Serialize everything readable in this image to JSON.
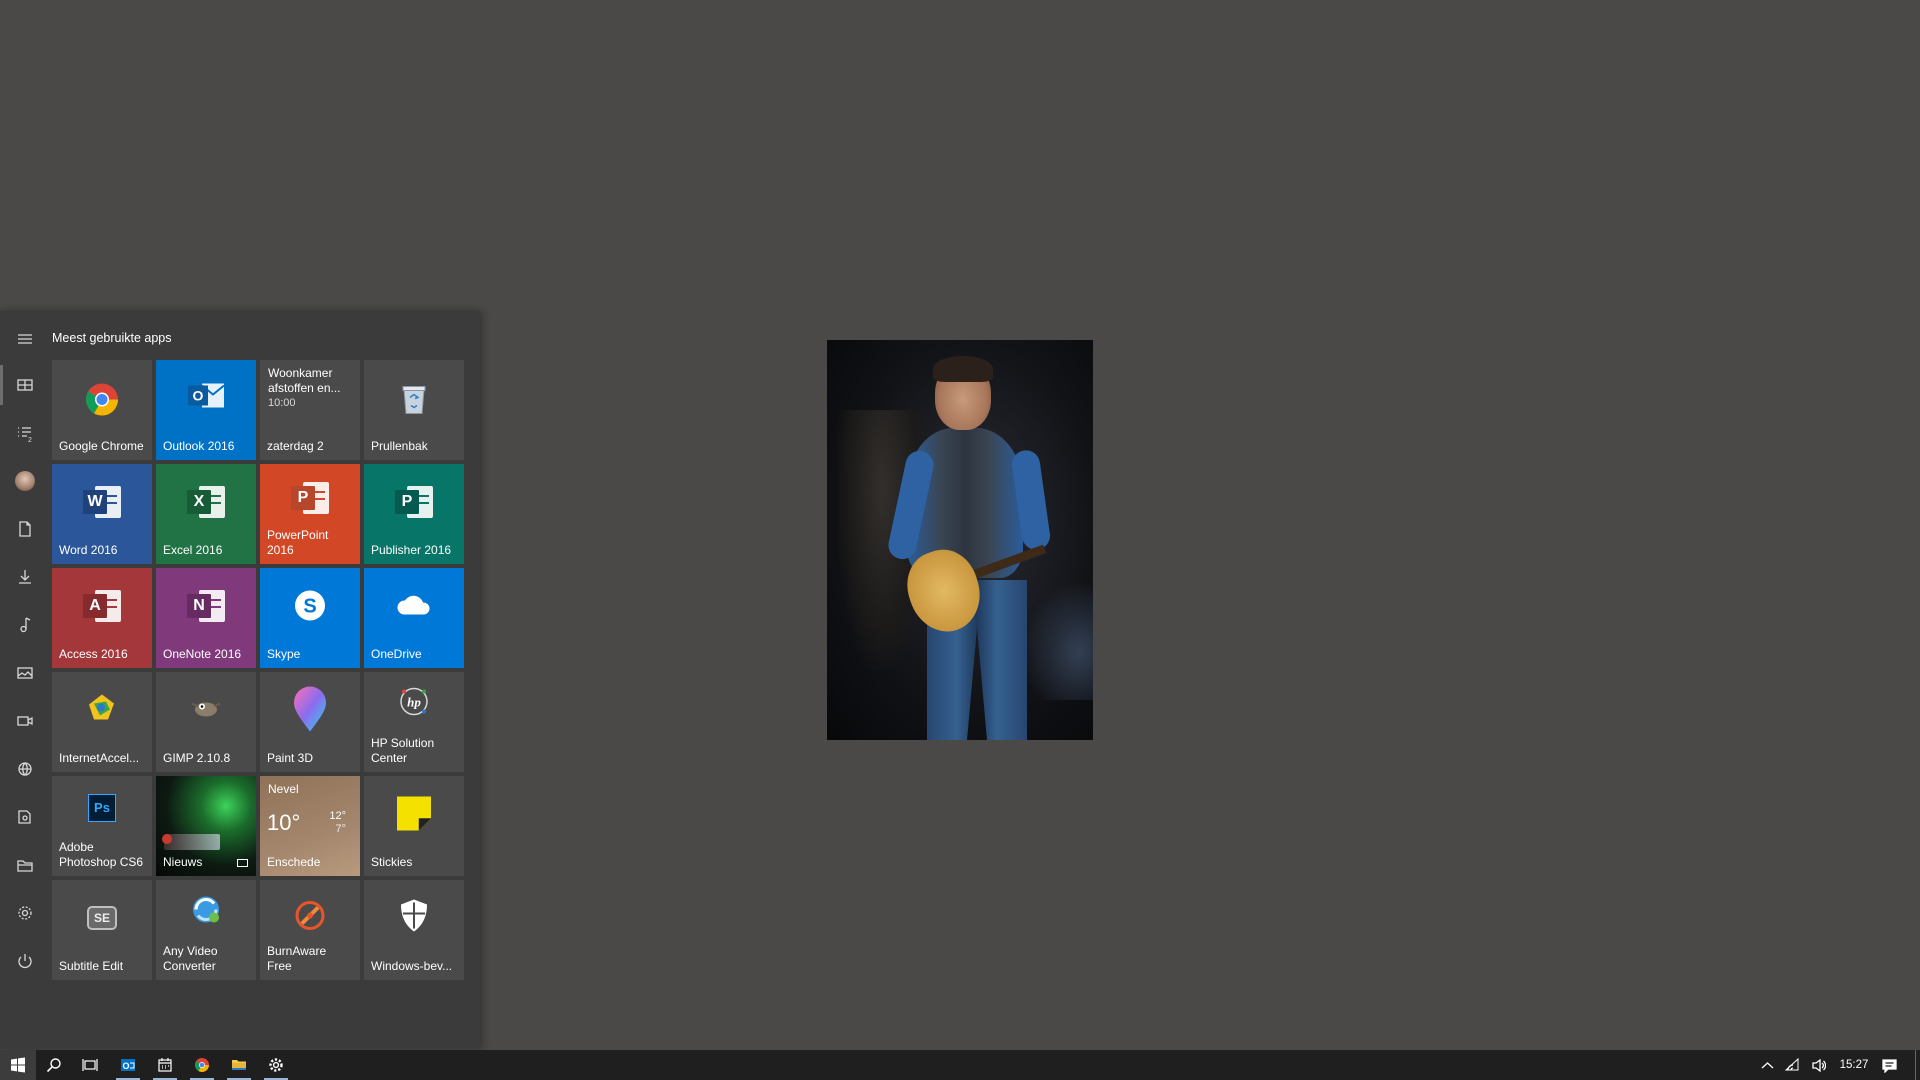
{
  "desktop": {
    "photo_name": "concert-photo"
  },
  "start_menu": {
    "group_title": "Meest gebruikte apps",
    "rail": [
      {
        "icon": "hamburger-menu-icon"
      },
      {
        "icon": "tiles-view-icon"
      },
      {
        "icon": "app-list-icon"
      },
      {
        "icon": "user-avatar"
      },
      {
        "icon": "documents-icon"
      },
      {
        "icon": "downloads-icon"
      },
      {
        "icon": "music-icon"
      },
      {
        "icon": "pictures-icon"
      },
      {
        "icon": "videos-icon"
      },
      {
        "icon": "network-icon"
      },
      {
        "icon": "personal-folder-icon"
      },
      {
        "icon": "file-explorer-icon"
      },
      {
        "icon": "settings-icon"
      },
      {
        "icon": "power-icon"
      }
    ],
    "tiles": {
      "chrome": {
        "label": "Google Chrome",
        "bg": "#4a4a4a"
      },
      "outlook": {
        "label": "Outlook 2016",
        "bg": "#0072c6",
        "letter": "O"
      },
      "calendar": {
        "event_title": "Woonkamer afstoffen en...",
        "event_time": "10:00",
        "day": "zaterdag 2",
        "bg": "#4a4a4a"
      },
      "recycle": {
        "label": "Prullenbak",
        "bg": "#4a4a4a"
      },
      "word": {
        "label": "Word 2016",
        "bg": "#2b579a",
        "letter": "W"
      },
      "excel": {
        "label": "Excel 2016",
        "bg": "#217346",
        "letter": "X"
      },
      "powerpoint": {
        "label": "PowerPoint 2016",
        "bg": "#d24726",
        "letter": "P"
      },
      "publisher": {
        "label": "Publisher 2016",
        "bg": "#077568",
        "letter": "P"
      },
      "access": {
        "label": "Access 2016",
        "bg": "#a4373a",
        "letter": "A"
      },
      "onenote": {
        "label": "OneNote 2016",
        "bg": "#80397b",
        "letter": "N"
      },
      "skype": {
        "label": "Skype",
        "bg": "#0078d7"
      },
      "onedrive": {
        "label": "OneDrive",
        "bg": "#0078d7"
      },
      "internetaccel": {
        "label": "InternetAccel...",
        "bg": "#4a4a4a"
      },
      "gimp": {
        "label": "GIMP 2.10.8",
        "bg": "#4a4a4a"
      },
      "paint3d": {
        "label": "Paint 3D",
        "bg": "#4a4a4a"
      },
      "hp": {
        "label": "HP Solution Center",
        "bg": "#4a4a4a"
      },
      "photoshop": {
        "label": "Adobe Photoshop CS6",
        "bg": "#4a4a4a",
        "letter": "Ps"
      },
      "news": {
        "label": "Nieuws",
        "bg": "#1a2a22"
      },
      "weather": {
        "condition": "Nevel",
        "temp": "10°",
        "high": "12°",
        "low": "7°",
        "city": "Enschede",
        "bg": "#9b7b61"
      },
      "stickies": {
        "label": "Stickies",
        "bg": "#4a4a4a"
      },
      "subtitle": {
        "label": "Subtitle Edit",
        "bg": "#4a4a4a",
        "letter": "SE"
      },
      "anyvideo": {
        "label": "Any Video Converter",
        "bg": "#4a4a4a"
      },
      "burnaware": {
        "label": "BurnAware Free",
        "bg": "#4a4a4a"
      },
      "defender": {
        "label": "Windows-bev...",
        "bg": "#4a4a4a"
      }
    }
  },
  "taskbar": {
    "clock": "15:27",
    "outlook_letter": "O",
    "colors": {
      "accent": "#0072c6",
      "running_indicator": "#9ab6d8"
    }
  }
}
